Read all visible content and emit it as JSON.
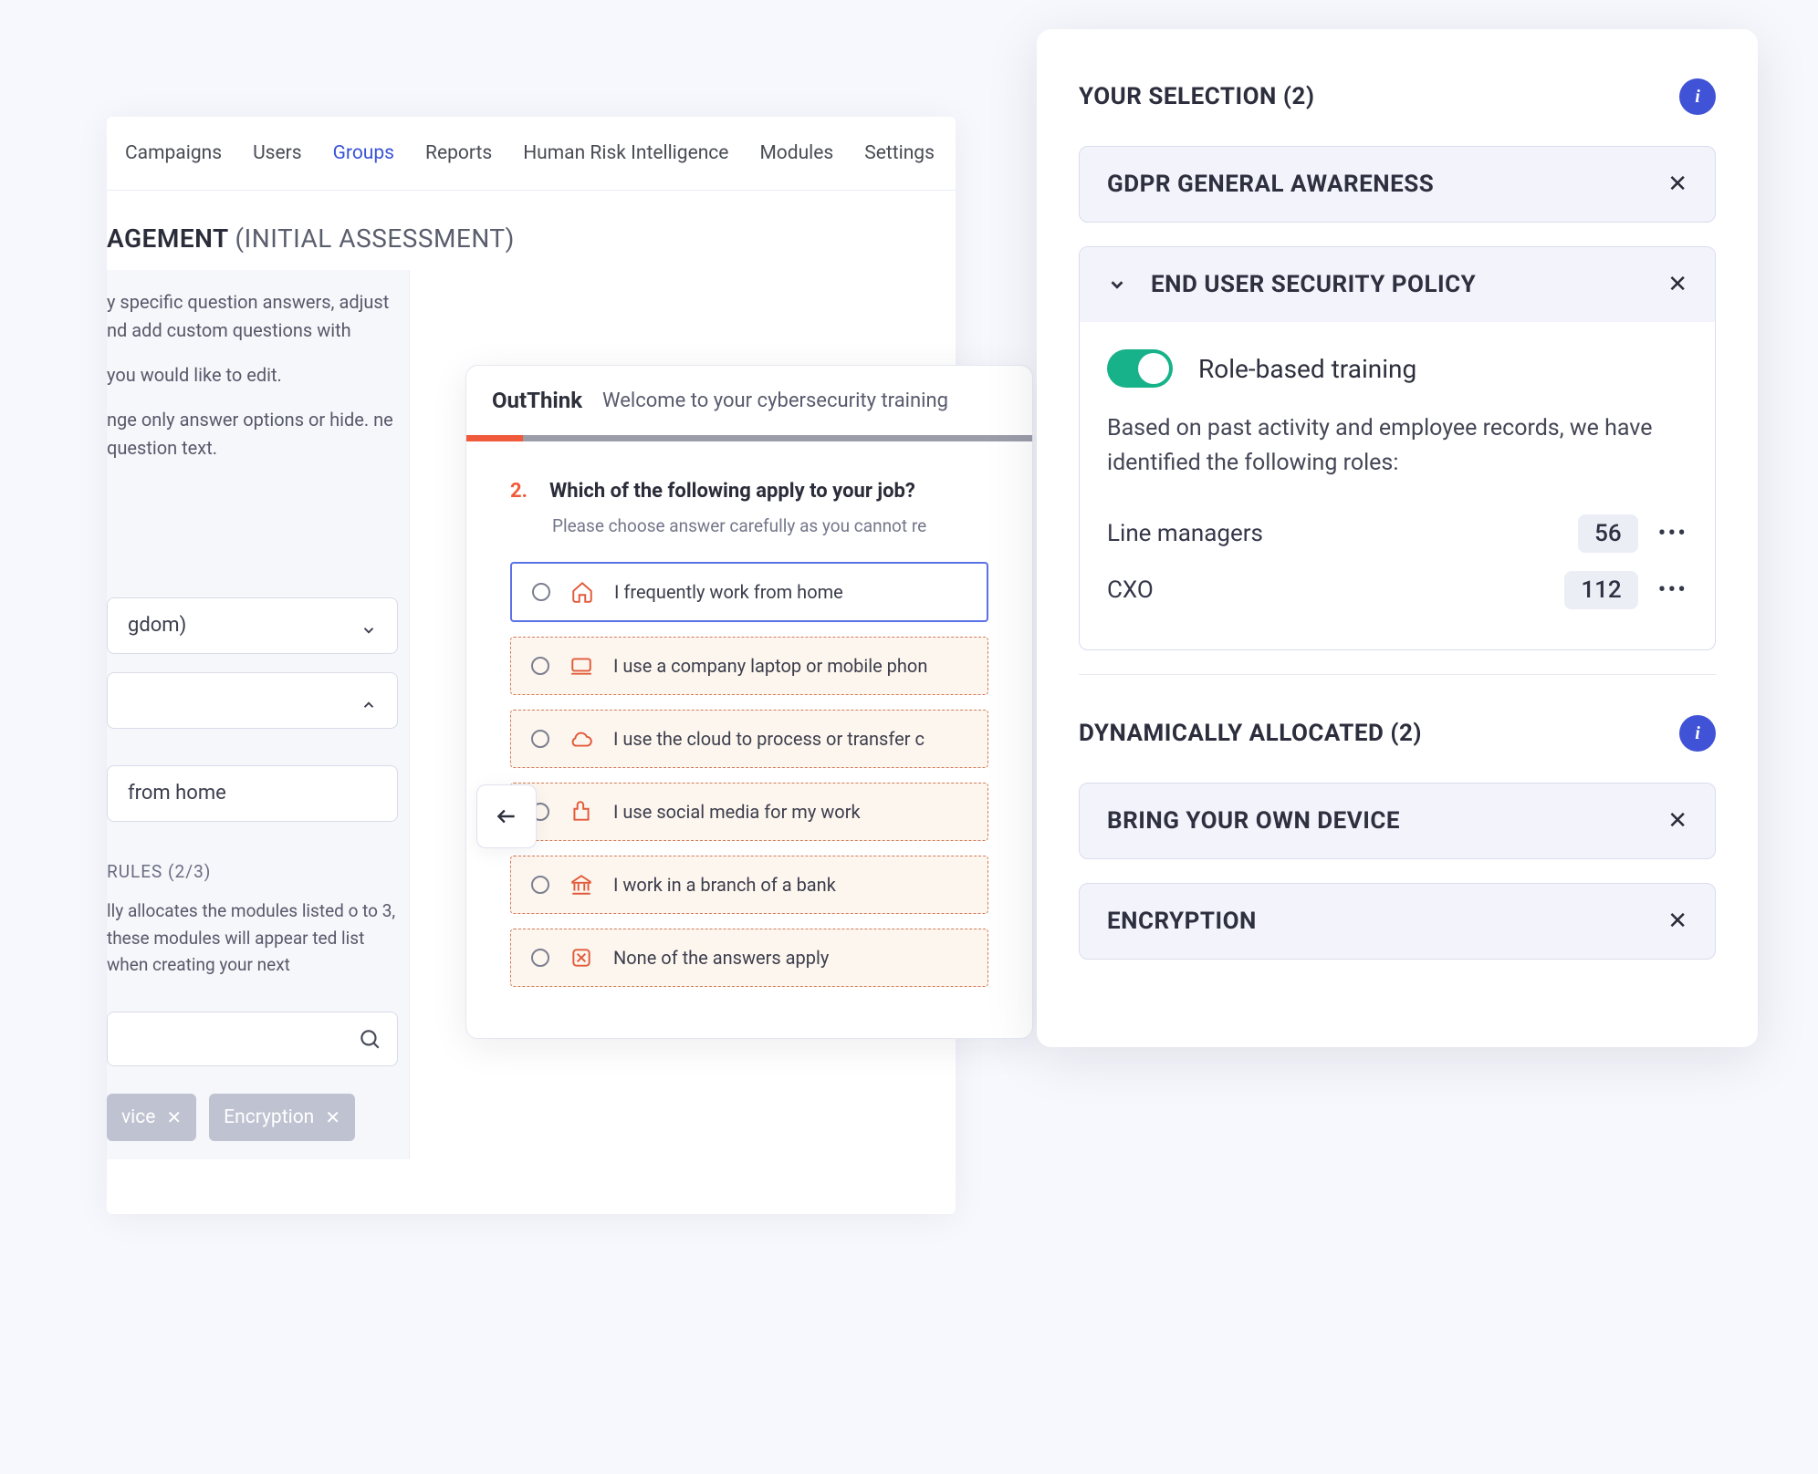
{
  "nav": {
    "items": [
      "Campaigns",
      "Users",
      "Groups",
      "Reports",
      "Human Risk Intelligence",
      "Modules",
      "Settings"
    ],
    "active_index": 2
  },
  "page": {
    "title_frag": "AGEMENT",
    "title_sub": "(INITIAL ASSESSMENT)"
  },
  "left": {
    "p1": "y specific question answers, adjust nd add custom questions with",
    "p2": "you would like to edit.",
    "p3": "nge only answer options or hide. ne question text.",
    "dd1": "gdom)",
    "dd3": "from home",
    "rules_h": "RULES (2/3)",
    "rules_p": "lly allocates the modules listed o to 3, these modules will appear ted list when creating your next",
    "chip1": "vice",
    "chip2": "Encryption"
  },
  "quiz": {
    "logo": "OutThink",
    "subtitle": "Welcome to your cybersecurity training",
    "number": "2.",
    "question": "Which of the following apply to your job?",
    "hint": "Please choose answer carefully as you cannot re",
    "answers": [
      "I frequently work from home",
      "I use a company laptop or mobile phon",
      "I use the cloud to process or transfer c",
      "I use social media for my work",
      "I work in a branch of a bank",
      "None of the answers apply"
    ]
  },
  "selection": {
    "header": "YOUR SELECTION (2)",
    "mod1": "GDPR GENERAL AWARENESS",
    "mod2": "END USER SECURITY POLICY",
    "toggle_label": "Role-based training",
    "desc": "Based on past activity and employee records, we have identified the following roles:",
    "roles": [
      {
        "name": "Line managers",
        "count": "56"
      },
      {
        "name": "CXO",
        "count": "112"
      }
    ],
    "dyn_header": "DYNAMICALLY ALLOCATED (2)",
    "dyn1": "BRING YOUR OWN DEVICE",
    "dyn2": "ENCRYPTION"
  }
}
